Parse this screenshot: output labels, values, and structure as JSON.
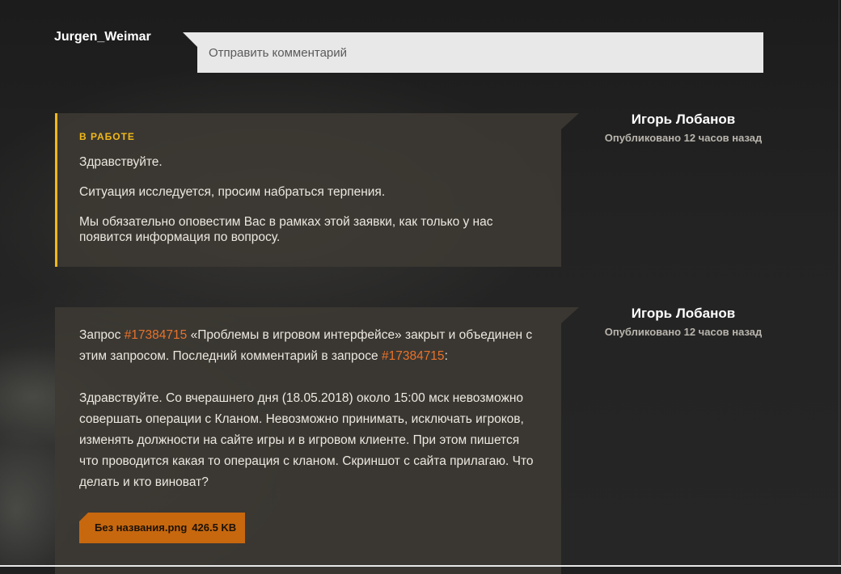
{
  "current_user": "Jurgen_Weimar",
  "comment_box": {
    "placeholder": "Отправить комментарий"
  },
  "messages": [
    {
      "status": "В РАБОТЕ",
      "paragraphs": [
        "Здравствуйте.",
        "Ситуация исследуется, просим набраться терпения.",
        "Мы обязательно оповестим Вас в рамках этой заявки, как только у нас появится информация по вопросу."
      ],
      "author": "Игорь Лобанов",
      "published": "Опубликовано 12 часов назад"
    },
    {
      "merge_notice": {
        "prefix": "Запрос ",
        "ticket_link": "#17384715",
        "middle": " «Проблемы в игровом интерфейсе» закрыт и объединен с этим запросом. Последний комментарий в запросе ",
        "ticket_link_2": "#17384715",
        "suffix": ":"
      },
      "body": "Здравствуйте. Со вчерашнего дня (18.05.2018) около 15:00 мск невозможно совершать операции с Кланом. Невозможно принимать, исключать игроков, изменять должности на сайте игры и в игровом клиенте. При этом пишется что проводится какая то операция с кланом. Скриншот с сайта прилагаю. Что делать и кто виноват?",
      "attachment": {
        "filename": "Без названия.png",
        "size": "426.5 KB"
      },
      "author": "Игорь Лобанов",
      "published": "Опубликовано 12 часов назад"
    }
  ],
  "colors": {
    "accent_yellow": "#f1b81a",
    "link_orange": "#e8722a",
    "attachment_bg": "#c7680f"
  }
}
